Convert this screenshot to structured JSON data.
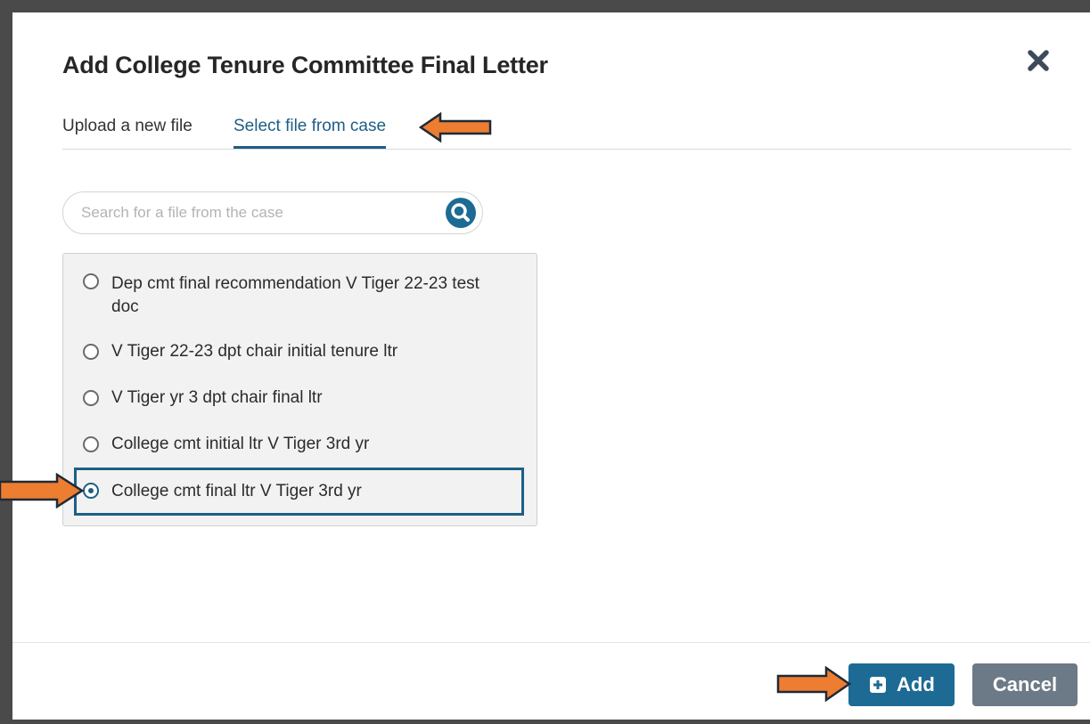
{
  "dialog": {
    "title": "Add College Tenure Committee Final Letter",
    "close_icon": "close-icon"
  },
  "tabs": [
    {
      "label": "Upload a new file",
      "active": false
    },
    {
      "label": "Select file from case",
      "active": true
    }
  ],
  "search": {
    "placeholder": "Search for a file from the case",
    "value": "",
    "icon": "search-icon"
  },
  "files": [
    {
      "label": "Dep cmt final recommendation V Tiger 22-23 test doc",
      "selected": false
    },
    {
      "label": "V Tiger 22-23 dpt chair initial tenure ltr",
      "selected": false
    },
    {
      "label": "V Tiger yr 3 dpt chair final ltr",
      "selected": false
    },
    {
      "label": "College cmt initial ltr V Tiger 3rd yr",
      "selected": false
    },
    {
      "label": "College cmt final ltr V Tiger 3rd yr",
      "selected": true
    }
  ],
  "footer": {
    "add_label": "Add",
    "add_icon": "plus-square-icon",
    "cancel_label": "Cancel"
  },
  "colors": {
    "accent": "#1d5f86",
    "add_button": "#1d6b94",
    "cancel_button": "#6c7a87",
    "annotation_arrow": "#ed7d31",
    "backdrop": "#4a4a4a"
  }
}
